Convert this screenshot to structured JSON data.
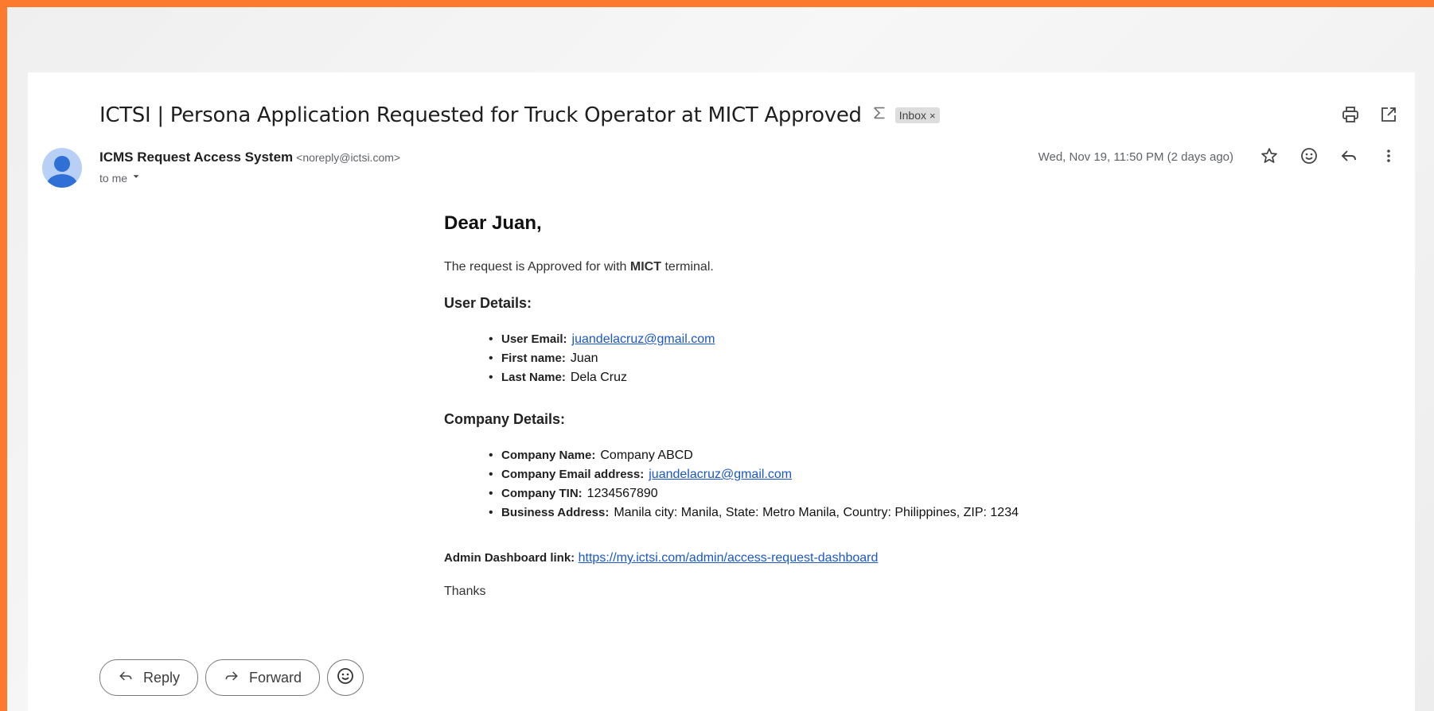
{
  "email": {
    "subject": "ICTSI | Persona Application Requested for Truck Operator at MICT Approved",
    "label_chip": "Inbox",
    "label_chip_close": "×",
    "sender_name": "ICMS Request Access System",
    "sender_email": "<noreply@ictsi.com>",
    "recipient": "to me",
    "date": "Wed, Nov 19, 11:50 PM (2 days ago)"
  },
  "icons": {
    "important": "importance-marker-icon",
    "print": "print-icon",
    "open_new_window": "open-in-new-window-icon",
    "star": "star-icon",
    "emoji": "emoji-icon",
    "reply": "reply-icon",
    "more": "more-vert-icon",
    "dropdown": "chevron-down-icon",
    "forward": "forward-icon"
  },
  "body": {
    "greeting": "Dear Juan,",
    "intro_prefix": "The request is Approved for with",
    "intro_bold": "MICT",
    "intro_suffix": "terminal.",
    "user_section_title": "User Details:",
    "user_details": [
      {
        "label": "User Email:",
        "value": "juandelacruz@gmail.com",
        "is_link": true
      },
      {
        "label": "First name:",
        "value": "Juan",
        "is_link": false
      },
      {
        "label": "Last Name:",
        "value": "Dela Cruz",
        "is_link": false
      }
    ],
    "company_section_title": "Company Details:",
    "company_details": [
      {
        "label": "Company Name:",
        "value": "Company ABCD",
        "is_link": false
      },
      {
        "label": "Company Email address:",
        "value": "juandelacruz@gmail.com",
        "is_link": true
      },
      {
        "label": "Company TIN:",
        "value": "1234567890",
        "is_link": false
      },
      {
        "label": "Business Address:",
        "value": "Manila city: Manila, State: Metro Manila, Country: Philippines, ZIP: 1234",
        "is_link": false
      }
    ],
    "admin_label": "Admin Dashboard link:",
    "admin_link": "https://my.ictsi.com/admin/access-request-dashboard",
    "closing": "Thanks"
  },
  "actions": {
    "reply_label": "Reply",
    "forward_label": "Forward"
  },
  "colors": {
    "frame": "#fb7a2e",
    "link": "#1a57c9",
    "avatar_bg": "#b9d0f6",
    "avatar_fg": "#2f6fd6"
  }
}
